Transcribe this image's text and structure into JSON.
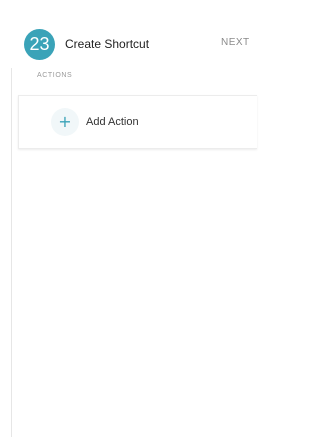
{
  "header": {
    "step_number": "23",
    "title": "Create Shortcut",
    "next_label": "NEXT"
  },
  "sections": {
    "actions_label": "ACTIONS"
  },
  "action_list": {
    "add_action_icon": "+",
    "add_action_label": "Add Action"
  },
  "colors": {
    "accent": "#3aa3b8",
    "text_primary": "#222222",
    "text_secondary": "#9a9a9a"
  },
  "icons": {
    "add_action": "plus-icon"
  }
}
